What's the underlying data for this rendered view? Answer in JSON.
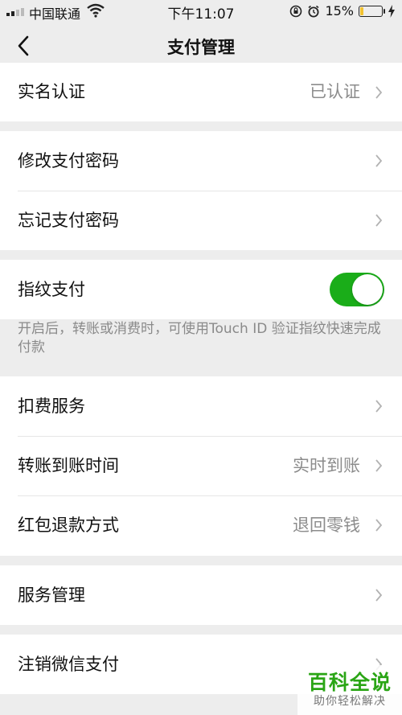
{
  "status_bar": {
    "carrier": "中国联通",
    "time": "下午11:07",
    "battery": "15%",
    "battery_level": 0.15
  },
  "nav": {
    "title": "支付管理"
  },
  "groups": {
    "identity": {
      "label": "实名认证",
      "value": "已认证"
    },
    "password": {
      "change": "修改支付密码",
      "forgot": "忘记支付密码"
    },
    "fingerprint": {
      "label": "指纹支付",
      "enabled": true,
      "description": "开启后，转账或消费时，可使用Touch ID 验证指纹快速完成付款"
    },
    "services": {
      "deduction": "扣费服务",
      "transfer_time": {
        "label": "转账到账时间",
        "value": "实时到账"
      },
      "red_packet_refund": {
        "label": "红包退款方式",
        "value": "退回零钱"
      }
    },
    "manage": {
      "label": "服务管理"
    },
    "cancel": {
      "label": "注销微信支付"
    }
  },
  "watermark": {
    "title": "百科全说",
    "subtitle": "助你轻松解决"
  },
  "colors": {
    "accent": "#1aad19",
    "watermark": "#2aa515"
  },
  "icons": [
    "signal-icon",
    "wifi-icon",
    "rotation-lock-icon",
    "alarm-icon",
    "battery-icon",
    "charging-icon",
    "back-arrow-icon",
    "chevron-right-icon"
  ]
}
